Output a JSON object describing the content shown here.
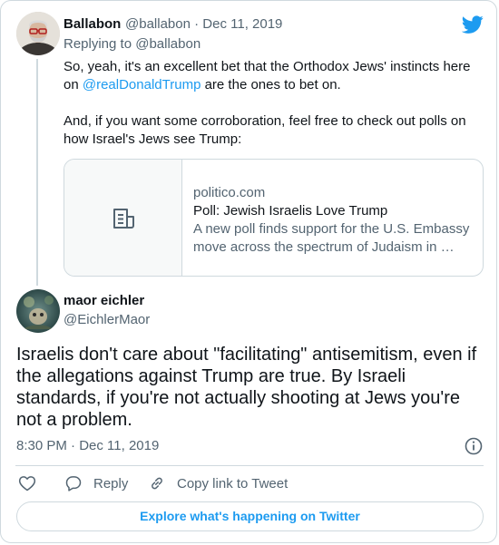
{
  "colors": {
    "accent": "#1d9bf0",
    "text": "#0f1419",
    "muted": "#536471",
    "border": "#cfd9de"
  },
  "parent_tweet": {
    "author_name": "Ballabon",
    "handle_and_date": "@ballabon · Dec 11, 2019",
    "replying_to": "Replying to @ballabon",
    "text_p1_before": "So, yeah, it's an excellent bet that the Orthodox Jews' instincts here on ",
    "mention": "@realDonaldTrump",
    "text_p1_after": " are the ones to bet on.",
    "text_p2": "And, if you want some corroboration, feel free to check out polls on how Israel's Jews see Trump:",
    "link_card": {
      "domain": "politico.com",
      "title": "Poll: Jewish Israelis Love Trump",
      "description": "A new poll finds support for the U.S. Embassy move across the spectrum of Judaism in …",
      "thumb_icon": "document-icon"
    }
  },
  "main_tweet": {
    "author_name": "maor eichler",
    "handle": "@EichlerMaor",
    "text": "Israelis don't care about \"facilitating\" antisemitism, even if the allegations against Trump are true. By Israeli standards, if you're not actually shooting at Jews you're not a problem.",
    "timestamp": "8:30 PM · Dec 11, 2019"
  },
  "actions": {
    "like_icon": "heart-icon",
    "reply_label": "Reply",
    "copy_label": "Copy link to Tweet"
  },
  "footer": {
    "explore_label": "Explore what's happening on Twitter"
  }
}
